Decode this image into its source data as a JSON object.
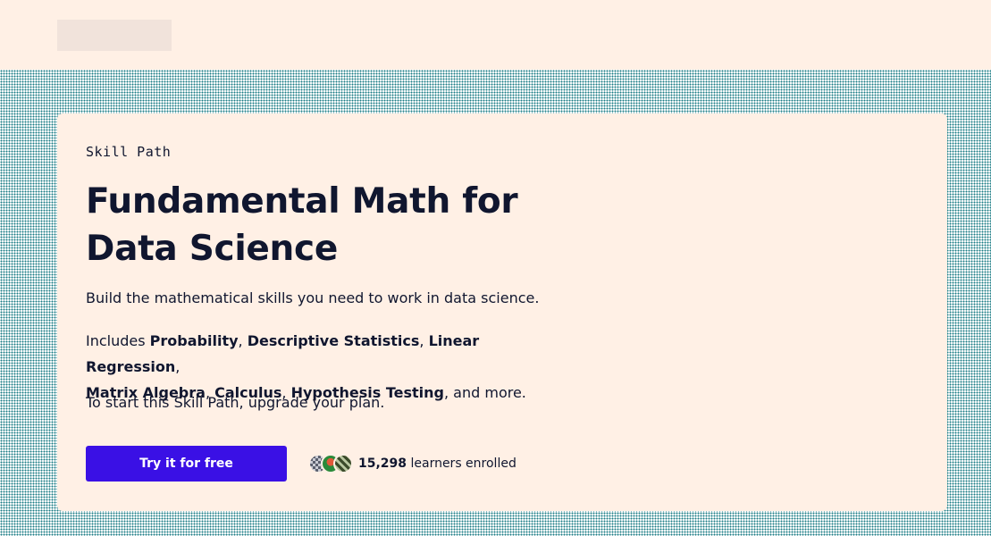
{
  "eyebrow": "Skill Path",
  "title": "Fundamental Math for Data Science",
  "description": "Build the mathematical skills you need to work in data science.",
  "includes": {
    "prefix": "Includes ",
    "topics": [
      "Probability",
      "Descriptive Statistics",
      "Linear Regression",
      "Matrix Algebra",
      "Calculus",
      "Hypothesis Testing"
    ],
    "separators": [
      ", ",
      ", ",
      ",",
      ", ",
      ", "
    ],
    "suffix": ", and more."
  },
  "upgrade_note": "To start this Skill Path, upgrade your plan.",
  "cta_label": "Try it for free",
  "enrollment": {
    "count": "15,298",
    "label": " learners enrolled"
  },
  "colors": {
    "background": "#fff0e5",
    "accent": "#3a10e5",
    "text": "#10162f"
  }
}
